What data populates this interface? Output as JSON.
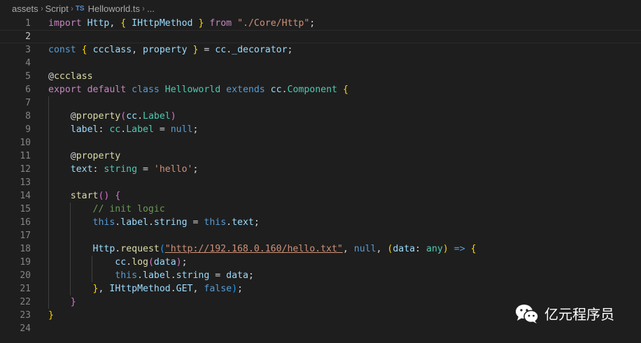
{
  "breadcrumb": {
    "items": [
      "assets",
      "Script",
      "Helloworld.ts",
      "..."
    ],
    "separator": "›",
    "file_icon": "TS"
  },
  "editor": {
    "lines": [
      {
        "n": "1",
        "guides": 0,
        "tokens": [
          [
            "kw",
            "import"
          ],
          [
            "pl",
            " "
          ],
          [
            "va",
            "Http"
          ],
          [
            "pl",
            ", "
          ],
          [
            "br1",
            "{"
          ],
          [
            "pl",
            " "
          ],
          [
            "va",
            "IHttpMethod"
          ],
          [
            "pl",
            " "
          ],
          [
            "br1",
            "}"
          ],
          [
            "pl",
            " "
          ],
          [
            "kw",
            "from"
          ],
          [
            "pl",
            " "
          ],
          [
            "str",
            "\"./Core/Http\""
          ],
          [
            "pl",
            ";"
          ]
        ]
      },
      {
        "n": "2",
        "guides": 0,
        "current": true,
        "tokens": []
      },
      {
        "n": "3",
        "guides": 0,
        "tokens": [
          [
            "st",
            "const"
          ],
          [
            "pl",
            " "
          ],
          [
            "br1",
            "{"
          ],
          [
            "pl",
            " "
          ],
          [
            "va",
            "ccclass"
          ],
          [
            "pl",
            ", "
          ],
          [
            "va",
            "property"
          ],
          [
            "pl",
            " "
          ],
          [
            "br1",
            "}"
          ],
          [
            "pl",
            " = "
          ],
          [
            "va",
            "cc"
          ],
          [
            "pl",
            "."
          ],
          [
            "va",
            "_decorator"
          ],
          [
            "pl",
            ";"
          ]
        ]
      },
      {
        "n": "4",
        "guides": 0,
        "tokens": []
      },
      {
        "n": "5",
        "guides": 0,
        "tokens": [
          [
            "pl",
            "@"
          ],
          [
            "fn",
            "ccclass"
          ]
        ]
      },
      {
        "n": "6",
        "guides": 0,
        "tokens": [
          [
            "kw",
            "export"
          ],
          [
            "pl",
            " "
          ],
          [
            "kw",
            "default"
          ],
          [
            "pl",
            " "
          ],
          [
            "st",
            "class"
          ],
          [
            "pl",
            " "
          ],
          [
            "cl",
            "Helloworld"
          ],
          [
            "pl",
            " "
          ],
          [
            "st",
            "extends"
          ],
          [
            "pl",
            " "
          ],
          [
            "va",
            "cc"
          ],
          [
            "pl",
            "."
          ],
          [
            "cl",
            "Component"
          ],
          [
            "pl",
            " "
          ],
          [
            "br1",
            "{"
          ]
        ]
      },
      {
        "n": "7",
        "guides": 1,
        "tokens": []
      },
      {
        "n": "8",
        "guides": 1,
        "tokens": [
          [
            "pl",
            "    @"
          ],
          [
            "fn",
            "property"
          ],
          [
            "br2",
            "("
          ],
          [
            "va",
            "cc"
          ],
          [
            "pl",
            "."
          ],
          [
            "cl",
            "Label"
          ],
          [
            "br2",
            ")"
          ]
        ]
      },
      {
        "n": "9",
        "guides": 1,
        "tokens": [
          [
            "pl",
            "    "
          ],
          [
            "va",
            "label"
          ],
          [
            "pl",
            ": "
          ],
          [
            "cl",
            "cc"
          ],
          [
            "pl",
            "."
          ],
          [
            "cl",
            "Label"
          ],
          [
            "pl",
            " = "
          ],
          [
            "st",
            "null"
          ],
          [
            "pl",
            ";"
          ]
        ]
      },
      {
        "n": "10",
        "guides": 1,
        "tokens": []
      },
      {
        "n": "11",
        "guides": 1,
        "tokens": [
          [
            "pl",
            "    @"
          ],
          [
            "fn",
            "property"
          ]
        ]
      },
      {
        "n": "12",
        "guides": 1,
        "tokens": [
          [
            "pl",
            "    "
          ],
          [
            "va",
            "text"
          ],
          [
            "pl",
            ": "
          ],
          [
            "cl",
            "string"
          ],
          [
            "pl",
            " = "
          ],
          [
            "str",
            "'hello'"
          ],
          [
            "pl",
            ";"
          ]
        ]
      },
      {
        "n": "13",
        "guides": 1,
        "tokens": []
      },
      {
        "n": "14",
        "guides": 1,
        "tokens": [
          [
            "pl",
            "    "
          ],
          [
            "fn",
            "start"
          ],
          [
            "br2",
            "()"
          ],
          [
            "pl",
            " "
          ],
          [
            "br2",
            "{"
          ]
        ]
      },
      {
        "n": "15",
        "guides": 2,
        "tokens": [
          [
            "pl",
            "        "
          ],
          [
            "cm",
            "// init logic"
          ]
        ]
      },
      {
        "n": "16",
        "guides": 2,
        "tokens": [
          [
            "pl",
            "        "
          ],
          [
            "st",
            "this"
          ],
          [
            "pl",
            "."
          ],
          [
            "va",
            "label"
          ],
          [
            "pl",
            "."
          ],
          [
            "va",
            "string"
          ],
          [
            "pl",
            " = "
          ],
          [
            "st",
            "this"
          ],
          [
            "pl",
            "."
          ],
          [
            "va",
            "text"
          ],
          [
            "pl",
            ";"
          ]
        ]
      },
      {
        "n": "17",
        "guides": 2,
        "tokens": []
      },
      {
        "n": "18",
        "guides": 2,
        "tokens": [
          [
            "pl",
            "        "
          ],
          [
            "va",
            "Http"
          ],
          [
            "pl",
            "."
          ],
          [
            "fn",
            "request"
          ],
          [
            "br3",
            "("
          ],
          [
            "str sq",
            "\"http://192.168.0.160/hello.txt\""
          ],
          [
            "pl",
            ", "
          ],
          [
            "st",
            "null"
          ],
          [
            "pl",
            ", "
          ],
          [
            "br1",
            "("
          ],
          [
            "va",
            "data"
          ],
          [
            "pl",
            ": "
          ],
          [
            "cl",
            "any"
          ],
          [
            "br1",
            ")"
          ],
          [
            "pl",
            " "
          ],
          [
            "st",
            "=>"
          ],
          [
            "pl",
            " "
          ],
          [
            "br1",
            "{"
          ]
        ]
      },
      {
        "n": "19",
        "guides": 3,
        "tokens": [
          [
            "pl",
            "            "
          ],
          [
            "va",
            "cc"
          ],
          [
            "pl",
            "."
          ],
          [
            "fn",
            "log"
          ],
          [
            "br2",
            "("
          ],
          [
            "va",
            "data"
          ],
          [
            "br2",
            ")"
          ],
          [
            "pl",
            ";"
          ]
        ]
      },
      {
        "n": "20",
        "guides": 3,
        "tokens": [
          [
            "pl",
            "            "
          ],
          [
            "st",
            "this"
          ],
          [
            "pl",
            "."
          ],
          [
            "va",
            "label"
          ],
          [
            "pl",
            "."
          ],
          [
            "va",
            "string"
          ],
          [
            "pl",
            " = "
          ],
          [
            "va",
            "data"
          ],
          [
            "pl",
            ";"
          ]
        ]
      },
      {
        "n": "21",
        "guides": 2,
        "tokens": [
          [
            "pl",
            "        "
          ],
          [
            "br1",
            "}"
          ],
          [
            "pl",
            ", "
          ],
          [
            "va",
            "IHttpMethod"
          ],
          [
            "pl",
            "."
          ],
          [
            "va",
            "GET"
          ],
          [
            "pl",
            ", "
          ],
          [
            "st",
            "false"
          ],
          [
            "br3",
            ")"
          ],
          [
            "pl",
            ";"
          ]
        ]
      },
      {
        "n": "22",
        "guides": 1,
        "tokens": [
          [
            "pl",
            "    "
          ],
          [
            "br2",
            "}"
          ]
        ]
      },
      {
        "n": "23",
        "guides": 0,
        "tokens": [
          [
            "br1",
            "}"
          ]
        ]
      },
      {
        "n": "24",
        "guides": 0,
        "tokens": []
      }
    ]
  },
  "watermark": {
    "text": "亿元程序员",
    "icon": "wechat-icon"
  }
}
